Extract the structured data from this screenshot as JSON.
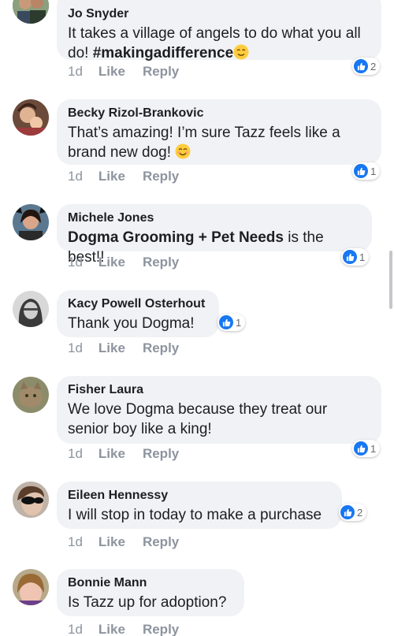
{
  "comments": [
    {
      "author": "Jo Snyder",
      "text_lines": [
        "It takes a village of angels to do what you all",
        "do! "
      ],
      "hashtag": "#makingadifference",
      "time": "1d",
      "like": "Like",
      "reply": "Reply",
      "reaction_count": "2"
    },
    {
      "author": "Becky Rizol-Brankovic",
      "text_lines": [
        "That’s amazing!  I’m sure Tazz feels like a",
        "brand new dog! "
      ],
      "time": "1d",
      "like": "Like",
      "reply": "Reply",
      "reaction_count": "1"
    },
    {
      "author": "Michele Jones",
      "mention": "Dogma Grooming + Pet Needs",
      "text_after": " is the best!!",
      "time": "1d",
      "like": "Like",
      "reply": "Reply",
      "reaction_count": "1"
    },
    {
      "author": "Kacy Powell Osterhout",
      "text": "Thank you Dogma!",
      "time": "1d",
      "like": "Like",
      "reply": "Reply",
      "reaction_count": "1"
    },
    {
      "author": "Fisher Laura",
      "text_lines": [
        "We love Dogma because they treat our",
        "senior boy like a king!"
      ],
      "time": "1d",
      "like": "Like",
      "reply": "Reply",
      "reaction_count": "1"
    },
    {
      "author": "Eileen Hennessy",
      "text": "I will stop in today to make a purchase",
      "time": "1d",
      "like": "Like",
      "reply": "Reply",
      "reaction_count": "2"
    },
    {
      "author": "Bonnie Mann",
      "text": "Is Tazz up for adoption?",
      "time": "1d",
      "like": "Like",
      "reply": "Reply"
    }
  ],
  "colors": {
    "like_blue": "#1877f2",
    "bubble_bg": "#f0f2f5",
    "meta_gray": "#8d949e"
  },
  "icons": {
    "reaction": "like-thumb-icon",
    "emoji_relieved": "relieved-face-emoji",
    "emoji_smile": "smiling-face-emoji"
  }
}
